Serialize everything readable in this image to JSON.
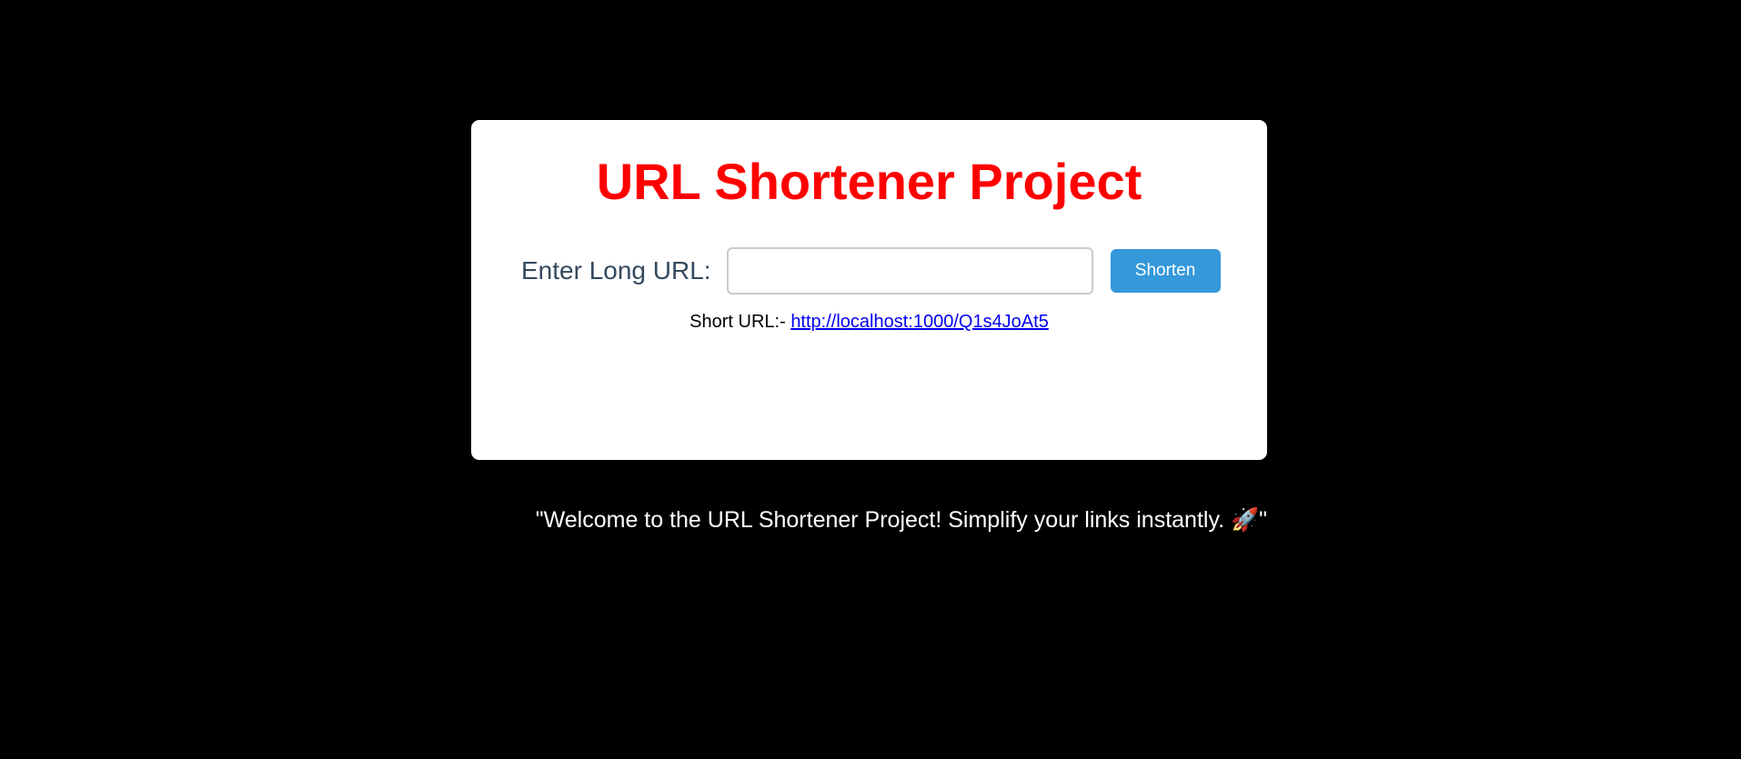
{
  "page": {
    "title": "URL Shortener Project",
    "colors": {
      "background": "#000000",
      "card": "#ffffff",
      "title": "#ff0000",
      "label": "#34495e",
      "button": "#3498db",
      "link": "#0000ee"
    }
  },
  "form": {
    "label": "Enter Long URL:",
    "input_value": "",
    "input_placeholder": "",
    "button_label": "Shorten"
  },
  "result": {
    "prefix": "Short URL:-",
    "link_text": "http://localhost:1000/Q1s4JoAt5"
  },
  "footer": {
    "welcome": "\"Welcome to the URL Shortener Project! Simplify your links instantly. 🚀\""
  }
}
